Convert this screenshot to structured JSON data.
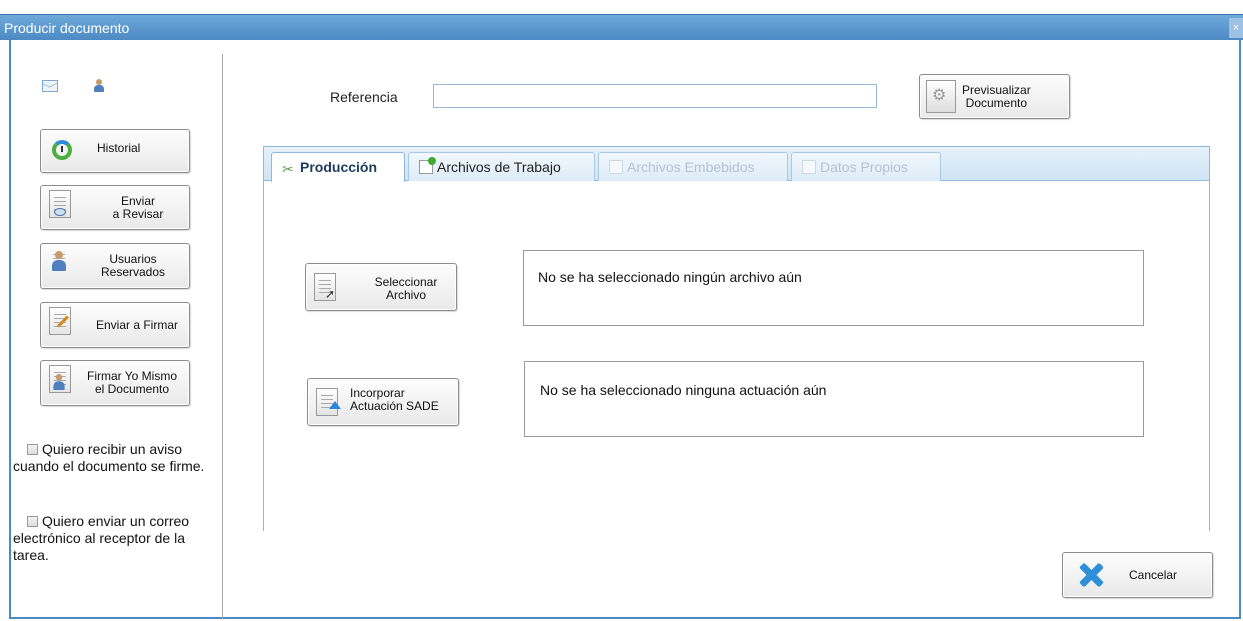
{
  "window": {
    "title": "Producir documento",
    "close_label": "×"
  },
  "left_panel": {
    "icons": [
      "mail-icon",
      "user-icon"
    ],
    "historial_label": "Historial",
    "buttons": [
      {
        "label_line1": "Enviar",
        "label_line2": "a Revisar",
        "icon": "eye-document-icon"
      },
      {
        "label_line1": "Usuarios",
        "label_line2": "Reservados",
        "icon": "users-icon"
      },
      {
        "label_line1": "Enviar a Firmar",
        "label_line2": "",
        "icon": "sign-pen-icon"
      },
      {
        "label_line1": "Firmar Yo Mismo",
        "label_line2": "el Documento",
        "icon": "self-sign-icon"
      }
    ],
    "checkboxes": [
      {
        "label": "Quiero recibir un aviso cuando el documento se firme.",
        "checked": false
      },
      {
        "label": "Quiero enviar un correo electrónico al receptor de la tarea.",
        "checked": false
      }
    ]
  },
  "header": {
    "referencia_label": "Referencia",
    "referencia_value": "",
    "preview_line1": "Previsualizar",
    "preview_line2": "Documento"
  },
  "tabs": [
    {
      "label": "Producción",
      "active": true,
      "enabled": true,
      "icon": "tools-icon"
    },
    {
      "label": "Archivos de Trabajo",
      "active": false,
      "enabled": true,
      "icon": "add-file-icon"
    },
    {
      "label": "Archivos Embebidos",
      "active": false,
      "enabled": false,
      "icon": "embedded-file-icon"
    },
    {
      "label": "Datos Propios",
      "active": false,
      "enabled": false,
      "icon": "edit-data-icon"
    }
  ],
  "produccion": {
    "select_line1": "Seleccionar",
    "select_line2": "Archivo",
    "file_status": "No se ha seleccionado ningún archivo aún",
    "incorporar_line1": "Incorporar",
    "incorporar_line2": "Actuación SADE",
    "actuacion_status": "No se ha seleccionado ninguna actuación aún"
  },
  "footer": {
    "cancel_label": "Cancelar"
  }
}
